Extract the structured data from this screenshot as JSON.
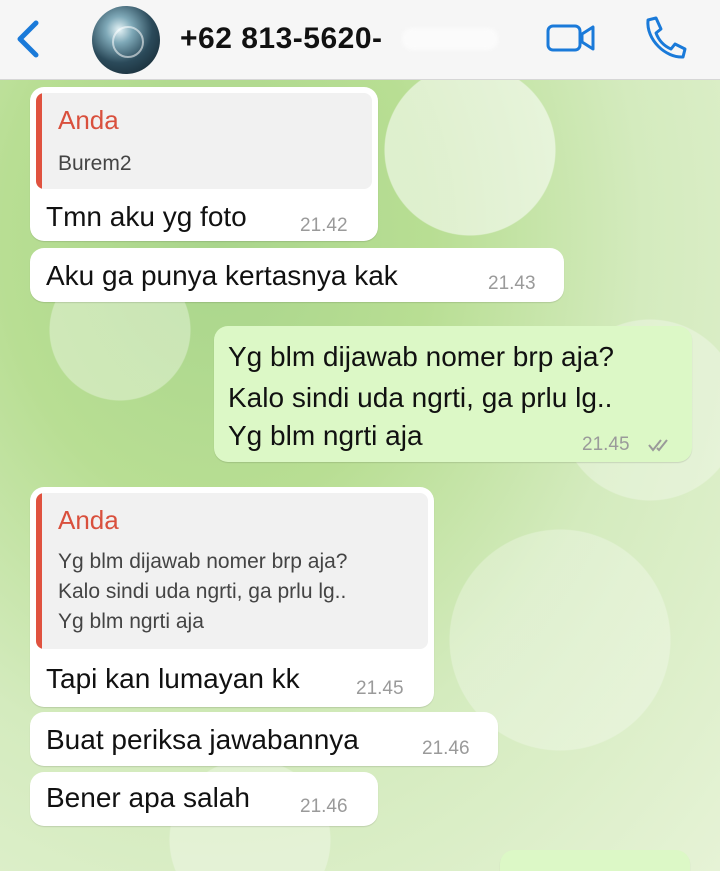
{
  "header": {
    "contact": "+62 813-5620-",
    "back_icon": "chevron-left-icon",
    "video_icon": "video-camera-icon",
    "call_icon": "phone-icon",
    "accent": "#1a7ad9"
  },
  "messages": [
    {
      "dir": "in",
      "quote_author": "Anda",
      "quote_lines": [
        "Burem2"
      ],
      "text_lines": [
        "Tmn aku yg foto"
      ],
      "time": "21.42"
    },
    {
      "dir": "in",
      "text_lines": [
        "Aku ga punya kertasnya kak"
      ],
      "time": "21.43"
    },
    {
      "dir": "out",
      "text_lines": [
        "Yg blm dijawab nomer brp aja?",
        "Kalo sindi uda ngrti, ga prlu lg..",
        "Yg blm ngrti aja"
      ],
      "time": "21.45",
      "read": true
    },
    {
      "dir": "in",
      "quote_author": "Anda",
      "quote_lines": [
        "Yg blm dijawab nomer brp aja?",
        "Kalo sindi uda ngrti, ga prlu lg..",
        "Yg blm ngrti aja"
      ],
      "text_lines": [
        "Tapi kan lumayan kk"
      ],
      "time": "21.45"
    },
    {
      "dir": "in",
      "text_lines": [
        "Buat periksa jawabannya"
      ],
      "time": "21.46"
    },
    {
      "dir": "in",
      "text_lines": [
        "Bener apa salah"
      ],
      "time": "21.46"
    }
  ],
  "colors": {
    "incoming": "#ffffff",
    "outgoing": "#dcf8c6",
    "quote_author": "#d9503d",
    "quote_bar": "#e0523f"
  }
}
